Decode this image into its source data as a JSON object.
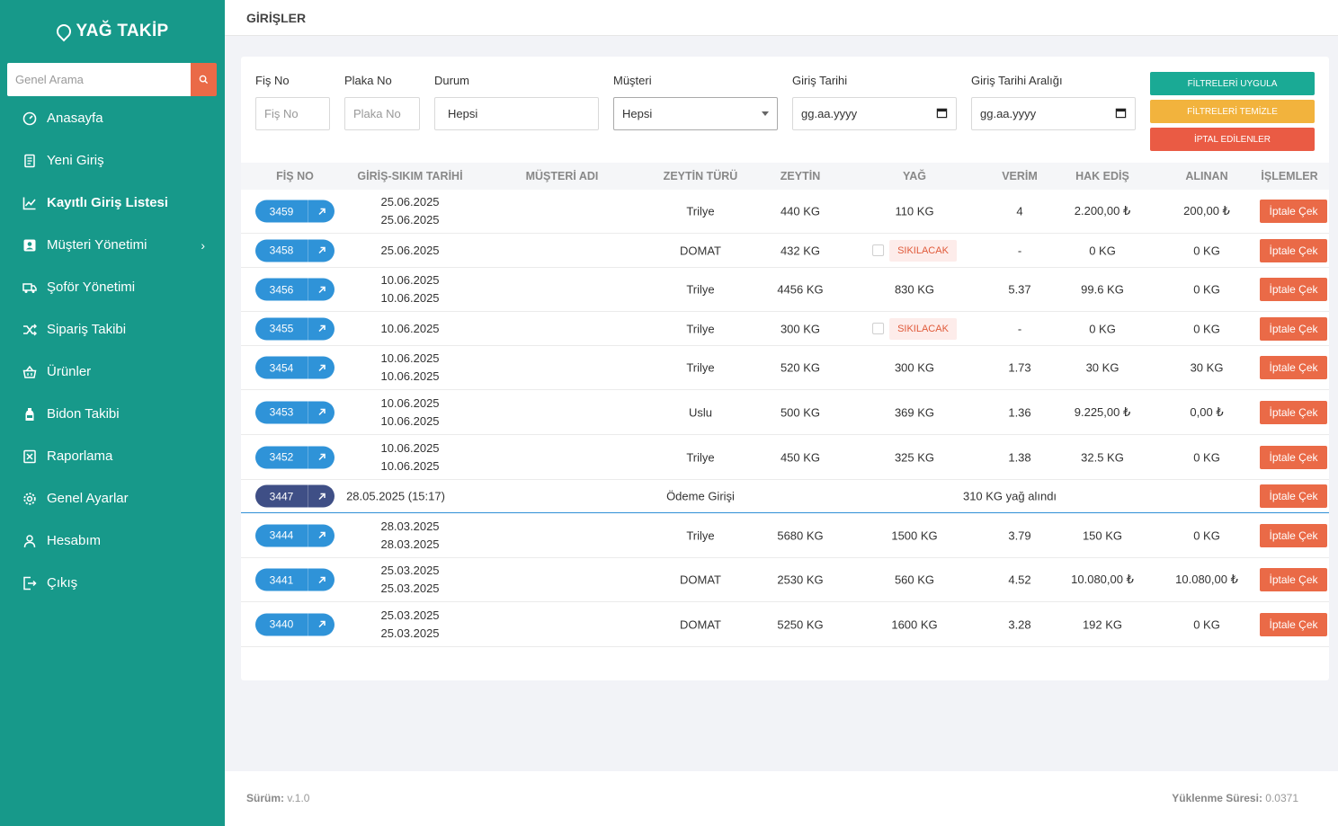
{
  "brand": {
    "name": "YAĞ TAKİP"
  },
  "search": {
    "placeholder": "Genel Arama"
  },
  "sidebar": {
    "items": [
      {
        "label": "Anasayfa",
        "icon": "dashboard-icon"
      },
      {
        "label": "Yeni Giriş",
        "icon": "new-entry-icon"
      },
      {
        "label": "Kayıtlı Giriş Listesi",
        "icon": "chart-line-icon",
        "active": true
      },
      {
        "label": "Müşteri Yönetimi",
        "icon": "customer-icon",
        "has_submenu": true
      },
      {
        "label": "Şoför Yönetimi",
        "icon": "truck-icon"
      },
      {
        "label": "Sipariş Takibi",
        "icon": "shuffle-icon"
      },
      {
        "label": "Ürünler",
        "icon": "basket-icon"
      },
      {
        "label": "Bidon Takibi",
        "icon": "bottle-icon"
      },
      {
        "label": "Raporlama",
        "icon": "report-icon"
      },
      {
        "label": "Genel Ayarlar",
        "icon": "gear-icon"
      },
      {
        "label": "Hesabım",
        "icon": "user-icon"
      },
      {
        "label": "Çıkış",
        "icon": "logout-icon"
      }
    ]
  },
  "header": {
    "title": "GİRİŞLER"
  },
  "filters": {
    "fis_no": {
      "label": "Fiş No",
      "placeholder": "Fiş No"
    },
    "plaka_no": {
      "label": "Plaka No",
      "placeholder": "Plaka No"
    },
    "durum": {
      "label": "Durum",
      "value": "Hepsi"
    },
    "musteri": {
      "label": "Müşteri",
      "value": "Hepsi"
    },
    "giris_tarihi": {
      "label": "Giriş Tarihi",
      "value": "gg.aa.yyyy"
    },
    "giris_tarihi_araligi": {
      "label": "Giriş Tarihi Aralığı",
      "value": "gg.aa.yyyy"
    },
    "apply_label": "FİLTRELERİ UYGULA",
    "clear_label": "FİLTRELERİ TEMİZLE",
    "cancelled_label": "İPTAL EDİLENLER"
  },
  "table": {
    "columns": [
      "FİŞ NO",
      "GİRİŞ-SIKIM TARİHİ",
      "MÜŞTERİ ADI",
      "ZEYTİN TÜRÜ",
      "ZEYTİN",
      "YAĞ",
      "VERİM",
      "HAK EDİŞ",
      "ALINAN",
      "İŞLEMLER"
    ],
    "action_label": "İptale Çek",
    "pending_label": "SIKILACAK",
    "rows": [
      {
        "fis": "3459",
        "date1": "25.06.2025",
        "date2": "25.06.2025",
        "tur": "Trilye",
        "zeytin": "440 KG",
        "yag": "110 KG",
        "verim": "4",
        "hak": "2.200,00 ₺",
        "alinan": "200,00 ₺"
      },
      {
        "fis": "3458",
        "date1": "25.06.2025",
        "date2": "",
        "tur": "DOMAT",
        "zeytin": "432 KG",
        "yag": "",
        "pending": true,
        "verim": "-",
        "hak": "0 KG",
        "alinan": "0 KG"
      },
      {
        "fis": "3456",
        "date1": "10.06.2025",
        "date2": "10.06.2025",
        "tur": "Trilye",
        "zeytin": "4456 KG",
        "yag": "830 KG",
        "verim": "5.37",
        "hak": "99.6 KG",
        "alinan": "0 KG"
      },
      {
        "fis": "3455",
        "date1": "10.06.2025",
        "date2": "",
        "tur": "Trilye",
        "zeytin": "300 KG",
        "yag": "",
        "pending": true,
        "verim": "-",
        "hak": "0 KG",
        "alinan": "0 KG"
      },
      {
        "fis": "3454",
        "date1": "10.06.2025",
        "date2": "10.06.2025",
        "tur": "Trilye",
        "zeytin": "520 KG",
        "yag": "300 KG",
        "verim": "1.73",
        "hak": "30 KG",
        "alinan": "30 KG"
      },
      {
        "fis": "3453",
        "date1": "10.06.2025",
        "date2": "10.06.2025",
        "tur": "Uslu",
        "zeytin": "500 KG",
        "yag": "369 KG",
        "verim": "1.36",
        "hak": "9.225,00 ₺",
        "alinan": "0,00 ₺"
      },
      {
        "fis": "3452",
        "date1": "10.06.2025",
        "date2": "10.06.2025",
        "tur": "Trilye",
        "zeytin": "450 KG",
        "yag": "325 KG",
        "verim": "1.38",
        "hak": "32.5 KG",
        "alinan": "0 KG"
      },
      {
        "fis": "3447",
        "payment": true,
        "date1": "28.05.2025 (15:17)",
        "tur": "Ödeme Girişi",
        "note": "310 KG yağ alındı"
      },
      {
        "fis": "3444",
        "date1": "28.03.2025",
        "date2": "28.03.2025",
        "tur": "Trilye",
        "zeytin": "5680 KG",
        "yag": "1500 KG",
        "verim": "3.79",
        "hak": "150 KG",
        "alinan": "0 KG"
      },
      {
        "fis": "3441",
        "date1": "25.03.2025",
        "date2": "25.03.2025",
        "tur": "DOMAT",
        "zeytin": "2530 KG",
        "yag": "560 KG",
        "verim": "4.52",
        "hak": "10.080,00 ₺",
        "alinan": "10.080,00 ₺"
      },
      {
        "fis": "3440",
        "date1": "25.03.2025",
        "date2": "25.03.2025",
        "tur": "DOMAT",
        "zeytin": "5250 KG",
        "yag": "1600 KG",
        "verim": "3.28",
        "hak": "192 KG",
        "alinan": "0 KG"
      }
    ]
  },
  "footer": {
    "version_label": "Sürüm:",
    "version": "v.1.0",
    "load_label": "Yüklenme Süresi:",
    "load_time": "0.0371"
  },
  "colors": {
    "sidebar": "#17998a",
    "primary": "#2f93d8",
    "payment": "#3f4f86",
    "danger": "#ea6a47",
    "success": "#1aaa95",
    "warning": "#f2b33d"
  }
}
